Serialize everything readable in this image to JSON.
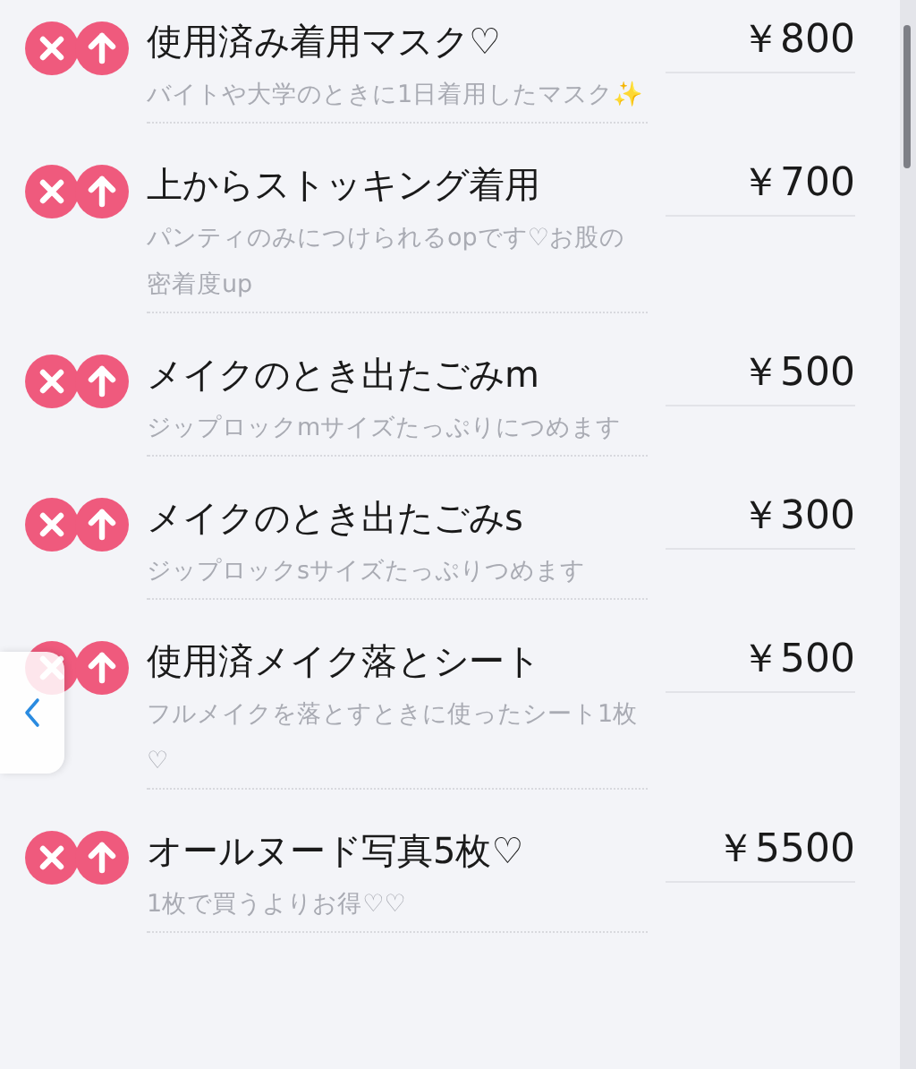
{
  "items": [
    {
      "title": "使用済み着用マスク♡",
      "price": "￥800",
      "description": "バイトや大学のときに1日着用したマスク✨"
    },
    {
      "title": "上からストッキング着用",
      "price": "￥700",
      "description": "パンティのみにつけられるopです♡お股の密着度up"
    },
    {
      "title": "メイクのとき出たごみm",
      "price": "￥500",
      "description": "ジップロックmサイズたっぷりにつめます"
    },
    {
      "title": "メイクのとき出たごみs",
      "price": "￥300",
      "description": "ジップロックsサイズたっぷりつめます"
    },
    {
      "title": "使用済メイク落とシート",
      "price": "￥500",
      "description": "フルメイクを落とすときに使ったシート1枚♡"
    },
    {
      "title": "オールヌード写真5枚♡",
      "price": "￥5500",
      "description": "1枚で買うよりお得♡♡"
    }
  ]
}
